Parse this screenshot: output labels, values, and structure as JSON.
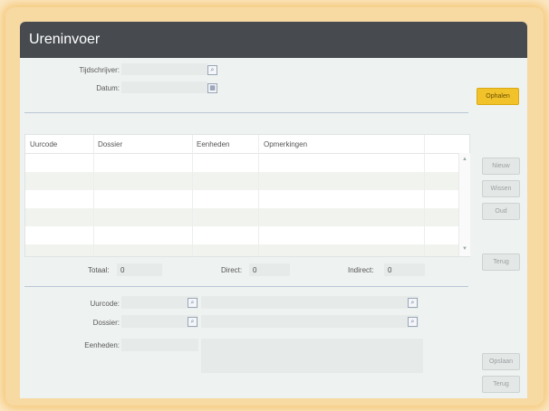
{
  "window": {
    "title": "Ureninvoer"
  },
  "header": {
    "tijdschrijver_label": "Tijdschrijver:",
    "tijdschrijver_value": "",
    "datum_label": "Datum:",
    "datum_value": "",
    "ophalen_label": "Ophalen"
  },
  "table": {
    "columns": [
      "Uurcode",
      "Dossier",
      "Eenheden",
      "Opmerkingen"
    ],
    "rows": [
      [
        "",
        "",
        "",
        ""
      ],
      [
        "",
        "",
        "",
        ""
      ],
      [
        "",
        "",
        "",
        ""
      ],
      [
        "",
        "",
        "",
        ""
      ],
      [
        "",
        "",
        "",
        ""
      ],
      [
        "",
        "",
        "",
        ""
      ]
    ]
  },
  "side_buttons": {
    "nieuw": "Nieuw",
    "wissen": "Wissen",
    "oud": "Oud",
    "terug": "Terug"
  },
  "totals": {
    "totaal_label": "Totaal:",
    "totaal_value": "0",
    "direct_label": "Direct:",
    "direct_value": "0",
    "indirect_label": "Indirect:",
    "indirect_value": "0"
  },
  "detail": {
    "uurcode_label": "Uurcode:",
    "dossier_label": "Dossier:",
    "eenheden_label": "Eenheden:",
    "opslaan_label": "Opslaan",
    "terug_label": "Terug"
  },
  "colors": {
    "titlebar": "#474b50",
    "accent": "#f2c22a",
    "background": "#eef2f1"
  }
}
